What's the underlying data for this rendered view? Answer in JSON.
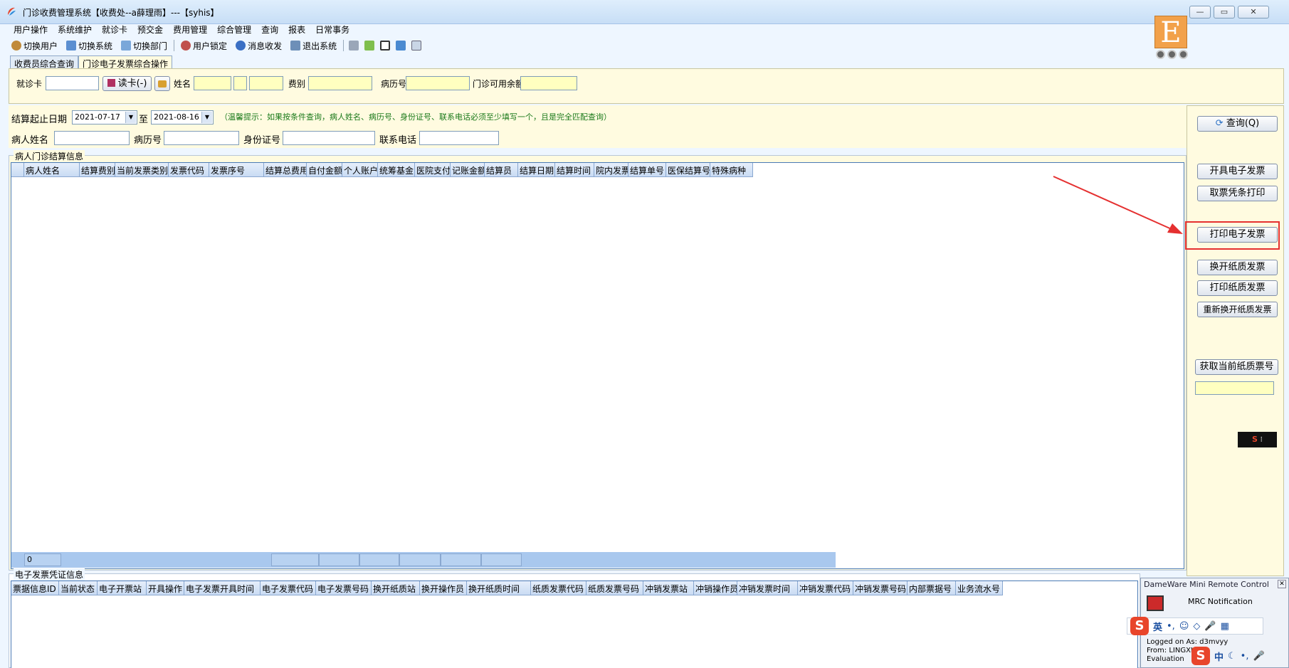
{
  "window": {
    "title": "门诊收费管理系统【收费处--a薛理雨】---【syhis】",
    "min": "—",
    "max": "▭",
    "close": "✕"
  },
  "menu": [
    "用户操作",
    "系统维护",
    "就诊卡",
    "预交金",
    "费用管理",
    "综合管理",
    "查询",
    "报表",
    "日常事务"
  ],
  "toolbar": {
    "switch_user": "切换用户",
    "switch_system": "切换系统",
    "switch_dept": "切换部门",
    "lock_user": "用户锁定",
    "messages": "消息收发",
    "exit": "退出系统"
  },
  "logo": {
    "letter": "E"
  },
  "tabs": [
    "收费员综合查询",
    "门诊电子发票综合操作"
  ],
  "top": {
    "card_label": "就诊卡",
    "read_card_btn": "读卡(-)",
    "name_label": "姓名",
    "fee_type_label": "费别",
    "record_label": "病历号",
    "balance_label": "门诊可用余额"
  },
  "filter": {
    "date_label": "结算起止日期",
    "start_date": "2021-07-17",
    "to_label": "至",
    "end_date": "2021-08-16",
    "hint": "（温馨提示：如果按条件查询，病人姓名、病历号、身份证号、联系电话必须至少填写一个，且是完全匹配查询）",
    "patient_name_label": "病人姓名",
    "record_label": "病历号",
    "id_label": "身份证号",
    "phone_label": "联系电话"
  },
  "settlement": {
    "title": "病人门诊结算信息",
    "columns": [
      "病人姓名",
      "结算费别",
      "当前发票类别",
      "发票代码",
      "发票序号",
      "结算总费用",
      "自付金额",
      "个人账户",
      "统筹基金",
      "医院支付",
      "记账金额",
      "结算员",
      "结算日期",
      "结算时间",
      "院内发票",
      "结算单号",
      "医保结算号",
      "特殊病种"
    ],
    "footer_count": "0"
  },
  "einvoice": {
    "title": "电子发票凭证信息",
    "columns": [
      "票据信息ID",
      "当前状态",
      "电子开票站",
      "开具操作",
      "电子发票开具时间",
      "电子发票代码",
      "电子发票号码",
      "换开纸质站",
      "换开操作员",
      "换开纸质时间",
      "纸质发票代码",
      "纸质发票号码",
      "冲销发票站",
      "冲销操作员",
      "冲销发票时间",
      "冲销发票代码",
      "冲销发票号码",
      "内部票据号",
      "业务流水号"
    ]
  },
  "actions": {
    "query": "查询(Q)",
    "issue_einvoice": "开具电子发票",
    "print_voucher": "取票凭条打印",
    "print_einvoice": "打印电子发票",
    "swap_paper": "换开纸质发票",
    "print_paper": "打印纸质发票",
    "reswap_paper": "重新换开纸质发票",
    "get_paper_no": "获取当前纸质票号"
  },
  "mrc": {
    "title": "DameWare Mini Remote Control",
    "notification": "MRC Notification",
    "logged_on": "Logged on As: d3mvyy",
    "from": "From: LINGXI",
    "evaluation": "Evaluation"
  },
  "ime": {
    "eng": "英",
    "zh": "中",
    "logo": "S"
  },
  "colors": {
    "highlight": "#e53030",
    "panel": "#fffbe0",
    "input_yellow": "#ffffc0",
    "grid_border": "#4a7ab5"
  }
}
